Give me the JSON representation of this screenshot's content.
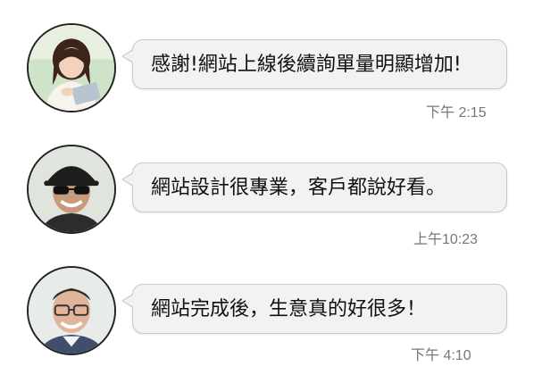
{
  "messages": [
    {
      "avatar_icon": "avatar-young-woman-with-tablet",
      "text": "感謝!網站上線後續詢單量明顯增加!",
      "time": "下午 2:15"
    },
    {
      "avatar_icon": "avatar-man-with-cap-and-sunglasses",
      "text": "網站設計很專業，客戶都說好看。",
      "time": "上午10:23"
    },
    {
      "avatar_icon": "avatar-older-man-with-glasses",
      "text": "網站完成後，生意真的好很多！",
      "time": "下午 4:10"
    }
  ],
  "colors": {
    "bubble_background": "#f2f2f2",
    "bubble_border": "#c8c8c8",
    "text": "#111111",
    "timestamp": "#777777"
  }
}
